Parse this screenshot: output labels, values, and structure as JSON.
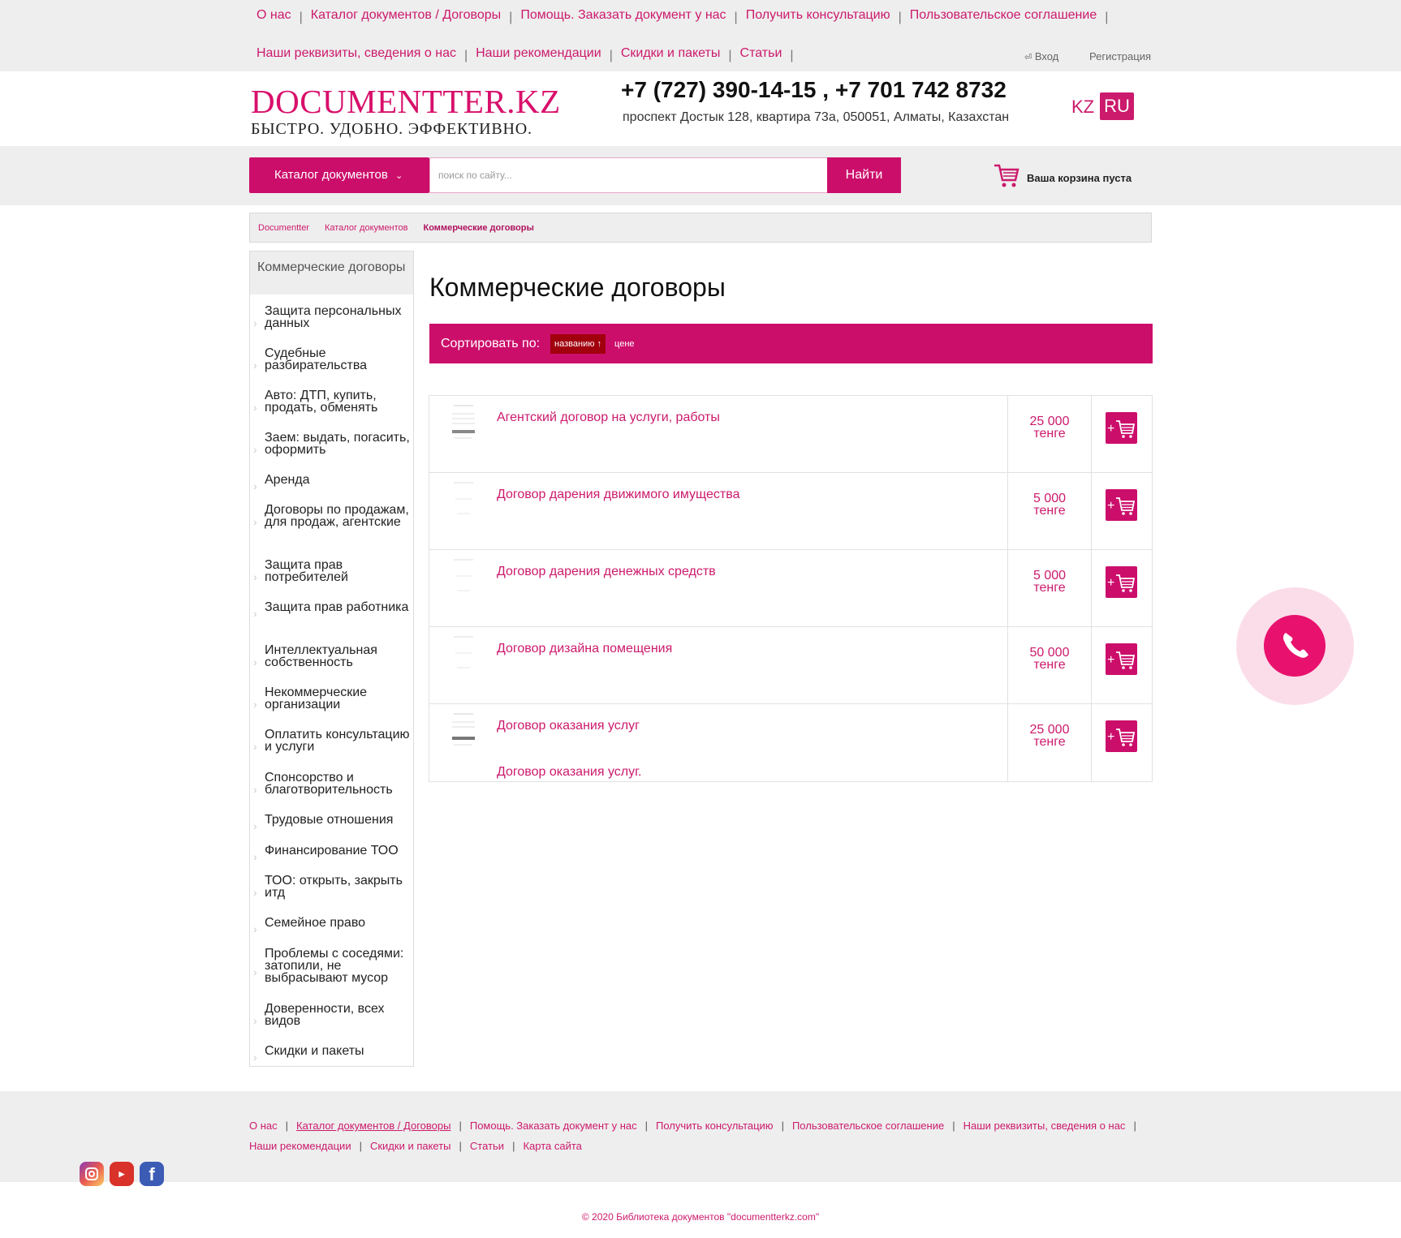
{
  "colors": {
    "accent": "#cc0e6b",
    "sort_active": "#a1000d",
    "grey_bg": "#eeeeee"
  },
  "top_nav": {
    "row1": [
      "О нас",
      "Каталог документов / Договоры",
      "Помощь. Заказать документ у нас",
      "Получить консультацию",
      "Пользовательское соглашение"
    ],
    "row2": [
      "Наши реквизиты, сведения о нас",
      "Наши рекомендации",
      "Скидки и пакеты",
      "Статьи"
    ],
    "login": "Вход",
    "register": "Регистрация"
  },
  "header": {
    "logo": "DOCUMENTTER.KZ",
    "slogan": "БЫСТРО. УДОБНО. ЭФФЕКТИВНО.",
    "phones": "+7 (727) 390-14-15 , +7 701 742 8732",
    "address": "проспект Достык 128, квартира 73а, 050051, Алматы, Казахстан",
    "lang_kz": "KZ",
    "lang_ru": "RU"
  },
  "search": {
    "catalog_button": "Каталог документов",
    "placeholder": "поиск по сайту...",
    "button": "Найти",
    "cart": "Ваша корзина пуста"
  },
  "breadcrumb": [
    "Documentter",
    "Каталог документов",
    "Коммерческие договоры"
  ],
  "sidebar": {
    "heading": "Коммерческие договоры",
    "items": [
      "Защита персональных данных",
      "Судебные разбирательства",
      "Авто: ДТП, купить, продать, обменять",
      "Заем: выдать, погасить, оформить",
      "Аренда",
      "Договоры по продажам, для продаж, агентские",
      "Защита прав потребителей",
      "Защита прав работника",
      "Интеллектуальная собственность",
      "Некоммерческие организации",
      "Оплатить консультацию и услуги",
      "Спонсорство и благотворительность",
      "Трудовые отношения",
      "Финансирование ТОО",
      "ТОО: открыть, закрыть итд",
      "Семейное право",
      "Проблемы с соседями: затопили, не выбрасывают мусор",
      "Доверенности, всех видов",
      "Скидки и пакеты"
    ]
  },
  "main": {
    "title": "Коммерческие договоры",
    "sort_label": "Сортировать по:",
    "sort_name": "названию ↑",
    "sort_price": "цене",
    "products": [
      {
        "title": "Агентский договор на услуги, работы",
        "price": "25 000",
        "currency": "тенге"
      },
      {
        "title": "Договор дарения движимого имущества",
        "price": "5 000",
        "currency": "тенге"
      },
      {
        "title": "Договор дарения денежных средств",
        "price": "5 000",
        "currency": "тенге"
      },
      {
        "title": "Договор дизайна помещения",
        "price": "50 000",
        "currency": "тенге"
      },
      {
        "title": "Договор оказания услуг",
        "price": "25 000",
        "currency": "тенге",
        "desc": "Договор оказания услуг."
      }
    ]
  },
  "footer": {
    "row1": [
      "О нас",
      "Каталог документов / Договоры",
      "Помощь. Заказать документ у нас",
      "Получить консультацию",
      "Пользовательское соглашение",
      "Наши реквизиты, сведения о нас"
    ],
    "row2": [
      "Наши рекомендации",
      "Скидки и пакеты",
      "Статьи",
      "Карта сайта"
    ],
    "copyright": "© 2020 Библиотека документов \"documentterkz.com\""
  },
  "icons": [
    "login-icon",
    "chevron-down-icon",
    "cart-icon",
    "add-to-cart-icon",
    "phone-icon",
    "instagram-icon",
    "youtube-icon",
    "facebook-icon"
  ]
}
